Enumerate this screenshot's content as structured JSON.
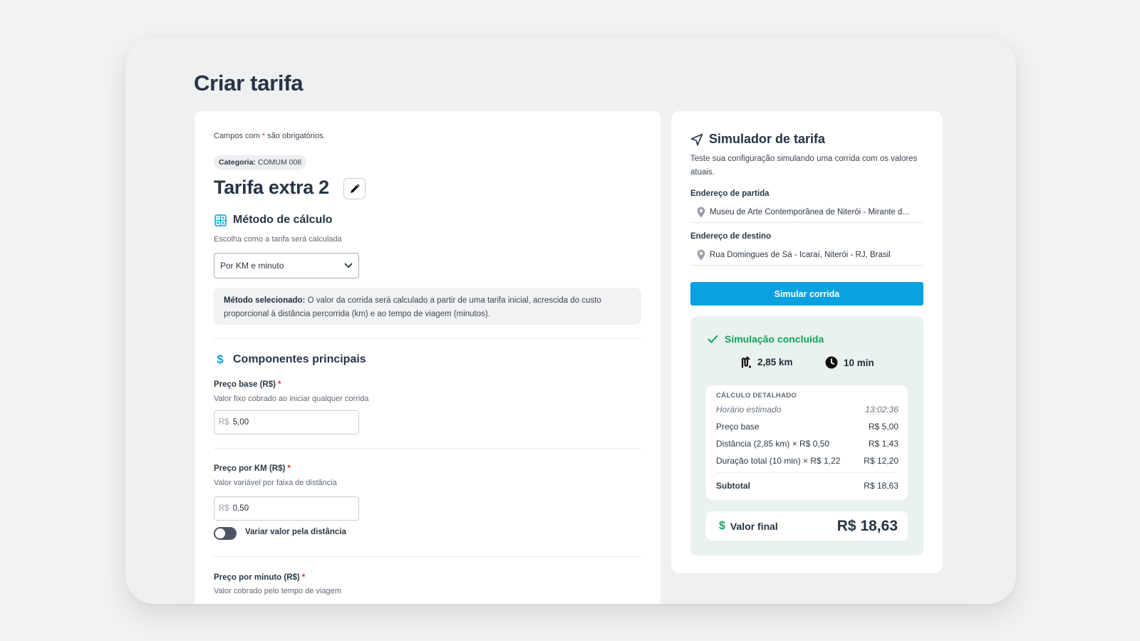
{
  "page": {
    "title": "Criar tarifa"
  },
  "form": {
    "required_note_prefix": "Campos com ",
    "required_marker": "*",
    "required_note_suffix": " são obrigatórios.",
    "category_label": "Categoria:",
    "category_value": "COMUM 008",
    "tariff_name": "Tarifa extra 2",
    "method_section": {
      "title": "Método de cálculo",
      "help": "Escolha como a tarifa será calculada",
      "selected": "Por KM e minuto",
      "info_label": "Método selecionado:",
      "info_text": " O valor da corrida será calculado a partir de uma tarifa inicial, acrescida do custo proporcional à distância percorrida (km) e ao tempo de viagem (minutos)."
    },
    "components_section": {
      "title": "Componentes principais",
      "currency_prefix": "R$",
      "base_price": {
        "label": "Preço base (R$)",
        "help": "Valor fixo cobrado ao iniciar qualquer corrida",
        "value": "5,00"
      },
      "price_per_km": {
        "label": "Preço por KM (R$)",
        "help": "Valor variável por faixa de distância",
        "value": "0,50"
      },
      "vary_toggle": {
        "label": "Variar valor pela distância",
        "on": false
      },
      "price_per_minute": {
        "label": "Preço por minuto (R$)",
        "help": "Valor cobrado pelo tempo de viagem"
      }
    }
  },
  "simulator": {
    "title": "Simulador de tarifa",
    "description": "Teste sua configuração simulando uma corrida com os valores atuais.",
    "origin_label": "Endereço de partida",
    "origin_value": "Museu de Arte Contemporânea de Niterói - Mirante d...",
    "destination_label": "Endereço de destino",
    "destination_value": "Rua Domingues de Sá - Icaraí, Niterói - RJ, Brasil",
    "button_label": "Simular corrida",
    "result": {
      "status": "Simulação concluída",
      "distance": "2,85 km",
      "duration": "10 min",
      "breakdown_title": "CÁLCULO DETALHADO",
      "rows": [
        {
          "label": "Horário estimado",
          "value": "13:02:36"
        },
        {
          "label": "Preço base",
          "value": "R$ 5,00"
        },
        {
          "label": "Distância (2,85 km) × R$ 0,50",
          "value": "R$ 1,43"
        },
        {
          "label": "Duração total (10 min) × R$ 1,22",
          "value": "R$ 12,20"
        }
      ],
      "subtotal_label": "Subtotal",
      "subtotal_value": "R$ 18,63",
      "final_label": "Valor final",
      "final_value": "R$ 18,63"
    }
  },
  "colors": {
    "accent": "#0aa1e0",
    "success": "#12a25c",
    "required": "#d0343a",
    "heading": "#263445"
  },
  "icons": {
    "edit": "pencil-icon",
    "method": "calculator-icon",
    "components": "dollar-icon",
    "simulator": "navigation-arrow-icon",
    "address": "map-pin-icon",
    "status": "check-icon",
    "distance": "route-icon",
    "duration": "clock-icon"
  }
}
